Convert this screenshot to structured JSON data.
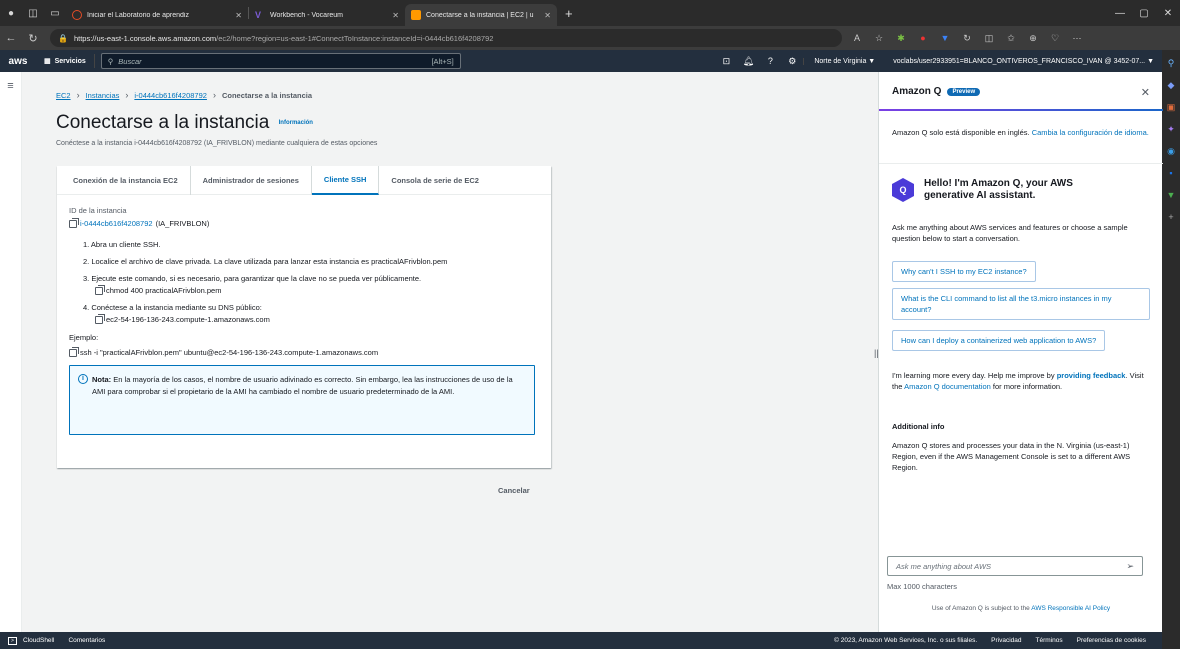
{
  "browser": {
    "tabs": [
      {
        "title": "Iniciar el Laboratorio de aprendiz",
        "color": "#e34c26"
      },
      {
        "title": "Workbench - Vocareum",
        "color": "#7b5cd6"
      },
      {
        "title": "Conectarse a la instancia | EC2 | u",
        "color": "#ff9900"
      }
    ],
    "url_host": "https://us-east-1.console.aws.amazon.com",
    "url_path": "/ec2/home?region=us-east-1#ConnectToInstance:instanceId=i-0444cb616f4208792"
  },
  "awsnav": {
    "logo": "aws",
    "services": "Servicios",
    "search_placeholder": "Buscar",
    "search_shortcut": "[Alt+S]",
    "region": "Norte de Virginia ▼",
    "account": "voclabs/user2933951=BLANCO_ONTIVEROS_FRANCISCO_IVAN @ 3452-07... ▼"
  },
  "breadcrumb": {
    "ec2": "EC2",
    "instances": "Instancias",
    "instance_id": "i-0444cb616f4208792",
    "current": "Conectarse a la instancia"
  },
  "page": {
    "title": "Conectarse a la instancia",
    "info": "Información",
    "subtitle": "Conéctese a la instancia i-0444cb616f4208792 (IA_FRIVBLON) mediante cualquiera de estas opciones"
  },
  "tabs": [
    {
      "label": "Conexión de la instancia EC2"
    },
    {
      "label": "Administrador de sesiones"
    },
    {
      "label": "Cliente SSH"
    },
    {
      "label": "Consola de serie de EC2"
    }
  ],
  "ssh": {
    "instance_label": "ID de la instancia",
    "instance_id": "i-0444cb616f4208792",
    "instance_name": "(IA_FRIVBLON)",
    "step1": "1. Abra un cliente SSH.",
    "step2": "2. Localice el archivo de clave privada. La clave utilizada para lanzar esta instancia es practicalAFrivblon.pem",
    "step3": "3. Ejecute este comando, si es necesario, para garantizar que la clave no se pueda ver públicamente.",
    "chmod": "chmod 400 practicalAFrivblon.pem",
    "step4": "4. Conéctese a la instancia mediante su DNS público:",
    "dns": "ec2-54-196-136-243.compute-1.amazonaws.com",
    "example_label": "Ejemplo:",
    "example_cmd": "ssh -i \"practicalAFrivblon.pem\" ubuntu@ec2-54-196-136-243.compute-1.amazonaws.com",
    "note_bold": "Nota:",
    "note_text": "En la mayoría de los casos, el nombre de usuario adivinado es correcto. Sin embargo, lea las instrucciones de uso de la AMI para comprobar si el propietario de la AMI ha cambiado el nombre de usuario predeterminado de la AMI.",
    "cancel": "Cancelar"
  },
  "q": {
    "title": "Amazon Q",
    "preview": "Preview",
    "note": "Amazon Q solo está disponible en inglés.",
    "note_link": "Cambia la configuración de idioma.",
    "hello": "Hello! I'm Amazon Q, your AWS generative AI assistant.",
    "intro": "Ask me anything about AWS services and features or choose a sample question below to start a conversation.",
    "suggestions": [
      "Why can't I SSH to my EC2 instance?",
      "What is the CLI command to list all the t3.micro instances in my account?",
      "How can I deploy a containerized web application to AWS?"
    ],
    "learn_pre": "I'm learning more every day. Help me improve by",
    "learn_link": "providing feedback",
    "learn_mid": ". Visit the",
    "learn_doc": "Amazon Q documentation",
    "learn_post": "for more information.",
    "additional_title": "Additional info",
    "additional_text": "Amazon Q stores and processes your data in the N. Virginia (us-east-1) Region, even if the AWS Management Console is set to a different AWS Region.",
    "input_placeholder": "Ask me anything about AWS",
    "max_chars": "Max 1000 characters",
    "terms_pre": "Use of Amazon Q is subject to the",
    "terms_link": "AWS Responsible AI Policy"
  },
  "footer": {
    "cloudshell": "CloudShell",
    "feedback": "Comentarios",
    "copyright": "© 2023, Amazon Web Services, Inc. o sus filiales.",
    "privacy": "Privacidad",
    "terms": "Términos",
    "cookies": "Preferencias de cookies"
  }
}
